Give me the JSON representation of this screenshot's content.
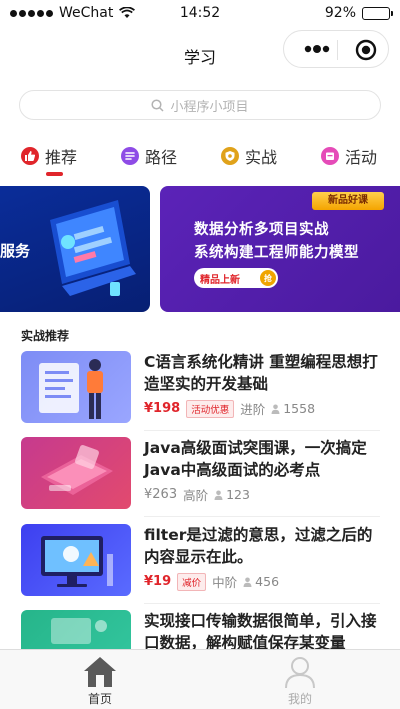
{
  "status_bar": {
    "carrier": "WeChat",
    "time": "14:52",
    "battery": "92%",
    "battery_level": 0.92
  },
  "nav": {
    "title": "学习",
    "more_icon": "more-dots-icon",
    "close_icon": "target-circle-icon"
  },
  "search": {
    "placeholder": "小程序小项目",
    "icon": "search-icon"
  },
  "tabs": [
    {
      "label": "推荐",
      "icon": "thumbs-up-icon",
      "color": "#e0252b",
      "active": true
    },
    {
      "label": "路径",
      "icon": "path-icon",
      "color": "#8e4be6",
      "active": false
    },
    {
      "label": "实战",
      "icon": "shield-icon",
      "color": "#e0a21a",
      "active": false
    },
    {
      "label": "活动",
      "icon": "activity-icon",
      "color": "#e54bb8",
      "active": false
    }
  ],
  "banners": {
    "left_text": "服务",
    "right_badge": "新品好课",
    "right_line1": "数据分析多项目实战",
    "right_line2": "系统构建工程师能力模型",
    "right_tag": "精品上新",
    "right_tag_badge": "抢"
  },
  "section": {
    "title": "实战推荐"
  },
  "courses": [
    {
      "title": "C语言系统化精讲 重塑编程思想打造坚实的开发基础",
      "price": "¥198",
      "price_highlight": true,
      "promo": "活动优惠",
      "level": "进阶",
      "students": "1558"
    },
    {
      "title": "Java高级面试突围课，一次搞定Java中高级面试的必考点",
      "price": "¥263",
      "price_highlight": false,
      "promo": "",
      "level": "高阶",
      "students": "123"
    },
    {
      "title": "filter是过滤的意思，过滤之后的内容显示在此。",
      "price": "¥19",
      "price_highlight": true,
      "promo": "减价",
      "level": "中阶",
      "students": "456"
    },
    {
      "title": "实现接口传输数据很简单，引入接口数据，解构赋值保存某变量",
      "price": "",
      "price_highlight": false,
      "promo": "",
      "level": "",
      "students": ""
    }
  ],
  "tabbar": {
    "items": [
      {
        "label": "首页",
        "icon": "home-icon",
        "active": true
      },
      {
        "label": "我的",
        "icon": "user-icon",
        "active": false
      }
    ],
    "active_color": "#333333",
    "inactive_color": "#aaaaaa"
  },
  "colors": {
    "accent": "#e0252b",
    "banner_left": "#0a2d9a",
    "banner_right": "#5b23b8"
  }
}
